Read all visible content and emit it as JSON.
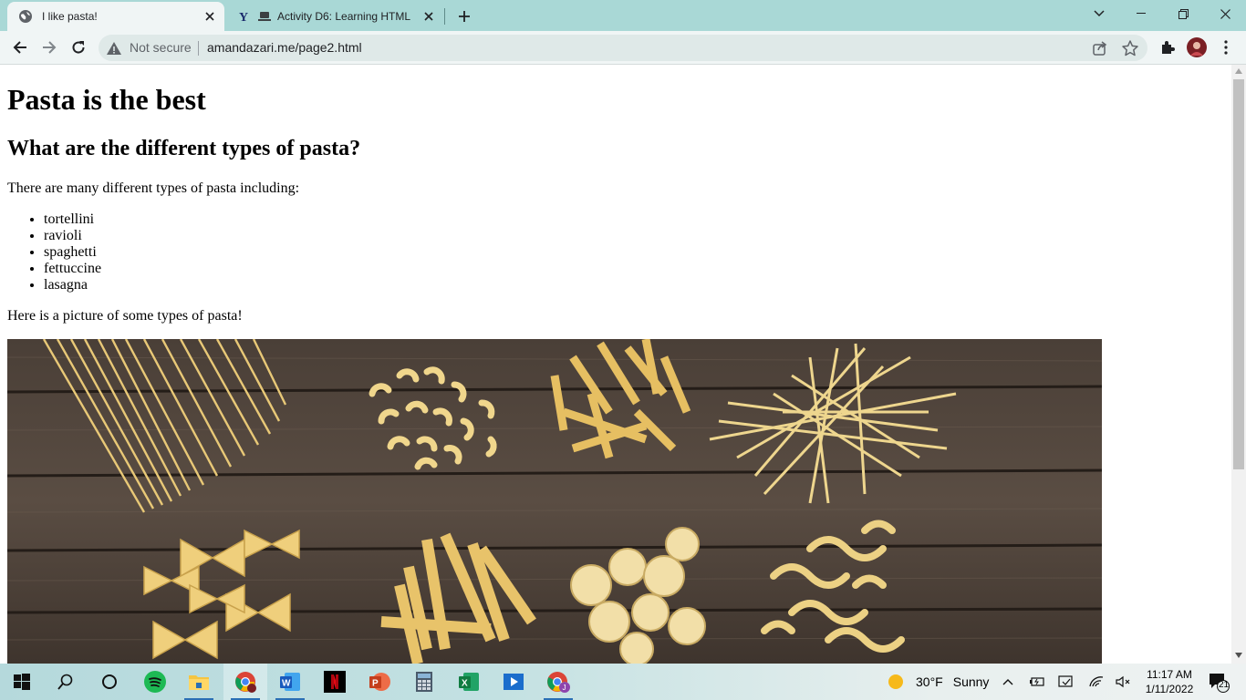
{
  "browser": {
    "tabs": [
      {
        "title": "I like pasta!",
        "icon": "globe-icon",
        "active": true
      },
      {
        "title": "Activity D6: Learning HTML",
        "icon": "y-logo-icon",
        "active": false
      }
    ],
    "address": {
      "security_label": "Not secure",
      "url": "amandazari.me/page2.html"
    }
  },
  "page": {
    "heading": "Pasta is the best",
    "subheading": "What are the different types of pasta?",
    "intro": "There are many different types of pasta including:",
    "pasta_types": [
      "tortellini",
      "ravioli",
      "spaghetti",
      "fettuccine",
      "lasagna"
    ],
    "picture_caption": "Here is a picture of some types of pasta!"
  },
  "taskbar": {
    "weather": {
      "temp": "30°F",
      "condition": "Sunny"
    },
    "clock": {
      "time": "11:17 AM",
      "date": "1/11/2022"
    },
    "notifications": "21",
    "apps": [
      "windows-start-icon",
      "search-icon",
      "cortana-icon",
      "spotify-icon",
      "file-explorer-icon",
      "chrome-icon",
      "word-icon",
      "netflix-icon",
      "powerpoint-icon",
      "calculator-icon",
      "excel-icon",
      "video-player-icon",
      "chrome-profile-icon"
    ]
  },
  "colors": {
    "tabstrip": "#a9d8d6",
    "toolbar": "#f0f5f5",
    "omnibox": "#dfe9e8",
    "taskbar_accent": "#2b6fb5"
  }
}
